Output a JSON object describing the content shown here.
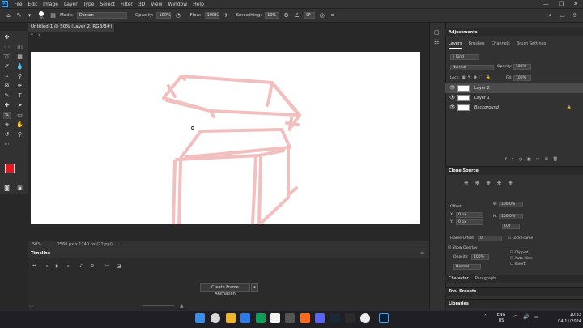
{
  "menubar": {
    "items": [
      "File",
      "Edit",
      "Image",
      "Layer",
      "Type",
      "Select",
      "Filter",
      "3D",
      "View",
      "Window",
      "Help"
    ]
  },
  "options": {
    "brush_size": "20",
    "mode_label": "Mode:",
    "mode_value": "Darken",
    "opacity_label": "Opacity:",
    "opacity_value": "100%",
    "flow_label": "Flow:",
    "flow_value": "100%",
    "smoothing_label": "Smoothing:",
    "smoothing_value": "10%",
    "angle_value": "0°"
  },
  "document": {
    "tab_title": "Untitled-1 @ 50% (Layer 2, RGB/8#) *",
    "zoom": "50%",
    "size_info": "2560 px x 1140 px (72 ppi)"
  },
  "timeline": {
    "title": "Timeline",
    "create_button": "Create Frame Animation"
  },
  "panels": {
    "adjustments": "Adjustments",
    "layer_tabs": [
      "Layers",
      "Brushes",
      "Channels",
      "Brush Settings"
    ],
    "kind": "Kind",
    "blend_mode": "Normal",
    "opacity_label": "Opacity:",
    "opacity_value": "100%",
    "lock_label": "Lock:",
    "fill_label": "Fill:",
    "fill_value": "100%",
    "layers": [
      {
        "name": "Layer 2",
        "selected": true
      },
      {
        "name": "Layer 1",
        "selected": false
      },
      {
        "name": "Background",
        "selected": false
      }
    ],
    "clone_source": "Clone Source",
    "offset_label": "Offset:",
    "x_label": "X:",
    "x_value": "0 px",
    "y_label": "Y:",
    "y_value": "0 px",
    "w_label": "W:",
    "w_value": "100,0%",
    "h_label": "H:",
    "h_value": "100,0%",
    "angle_value": "0,0",
    "frame_offset_label": "Frame Offset:",
    "frame_offset_value": "0",
    "lock_frame": "Lock Frame",
    "show_overlay": "Show Overlay",
    "overlay_opacity_label": "Opacity:",
    "overlay_opacity_value": "100%",
    "clipped": "Clipped",
    "auto_hide": "Auto Hide",
    "invert": "Invert",
    "overlay_mode": "Normal",
    "character_tabs": [
      "Character",
      "Paragraph"
    ],
    "tool_presets": "Tool Presets",
    "libraries": "Libraries"
  },
  "taskbar": {
    "lang_1": "ENG",
    "lang_2": "US",
    "time": "10:33",
    "date": "04/11/2024"
  },
  "colors": {
    "foreground": "#e8161d",
    "background": "#e81bd6",
    "sketch": "#f2b8b8"
  }
}
